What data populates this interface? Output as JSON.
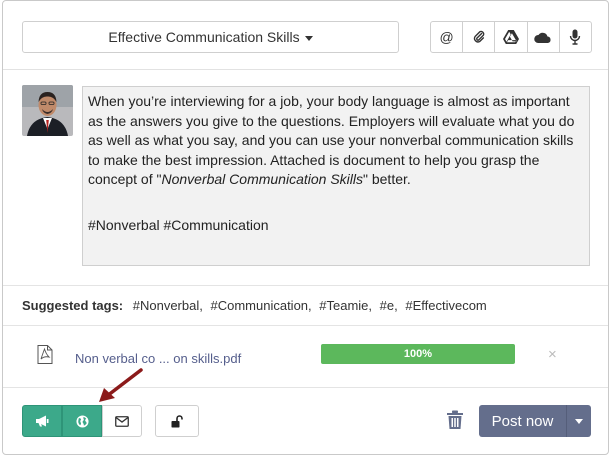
{
  "header": {
    "group_name": "Effective Communication Skills",
    "attach_icons": [
      "at-icon",
      "paperclip-icon",
      "google-drive-icon",
      "onedrive-icon",
      "microphone-icon"
    ]
  },
  "message": {
    "body_before_em": "When you’re interviewing for a job, your body language is almost as important as the answers you give to the questions. Employers will evaluate what you do as well as what you say, and you can use your nonverbal communication skills to make the best impression. Attached is document to help you grasp the concept of \"",
    "body_em": "Nonverbal Communication Skills",
    "body_after_em": "\" better.",
    "hashtags": "#Nonverbal #Communication"
  },
  "suggested": {
    "label": "Suggested tags:",
    "tags": [
      "#Nonverbal,",
      "#Communication,",
      "#Teamie,",
      "#e,",
      "#Effectivecom"
    ]
  },
  "attachment": {
    "file_name": "Non verbal co ... on skills.pdf",
    "progress_label": "100%",
    "progress_value": 1.0,
    "remove_symbol": "×"
  },
  "footer": {
    "post_label": "Post now"
  },
  "colors": {
    "accent_green": "#3ca98a",
    "post_button": "#646e8c",
    "progress_green": "#5cb85c",
    "arrow": "#8b1a1a"
  }
}
